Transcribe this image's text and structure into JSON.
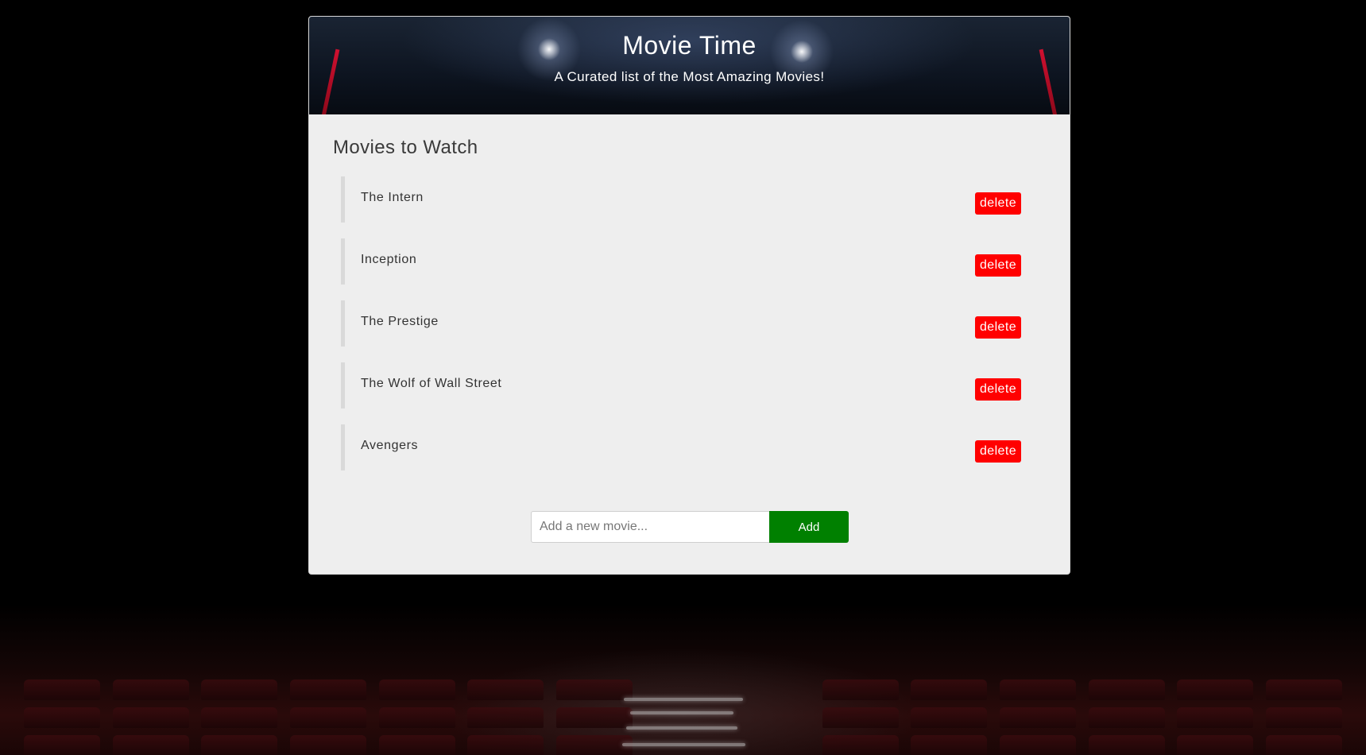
{
  "header": {
    "title": "Movie Time",
    "subtitle": "A Curated list of the Most Amazing Movies!"
  },
  "main": {
    "section_title": "Movies to Watch",
    "movies": [
      {
        "title": "The Intern",
        "delete_label": "delete"
      },
      {
        "title": "Inception",
        "delete_label": "delete"
      },
      {
        "title": "The Prestige",
        "delete_label": "delete"
      },
      {
        "title": "The Wolf of Wall Street",
        "delete_label": "delete"
      },
      {
        "title": "Avengers",
        "delete_label": "delete"
      }
    ]
  },
  "form": {
    "input_value": "",
    "input_placeholder": "Add a new movie...",
    "add_label": "Add"
  },
  "colors": {
    "delete": "#ff0000",
    "add": "#008000",
    "card": "#eeeeee",
    "background": "#000000"
  }
}
